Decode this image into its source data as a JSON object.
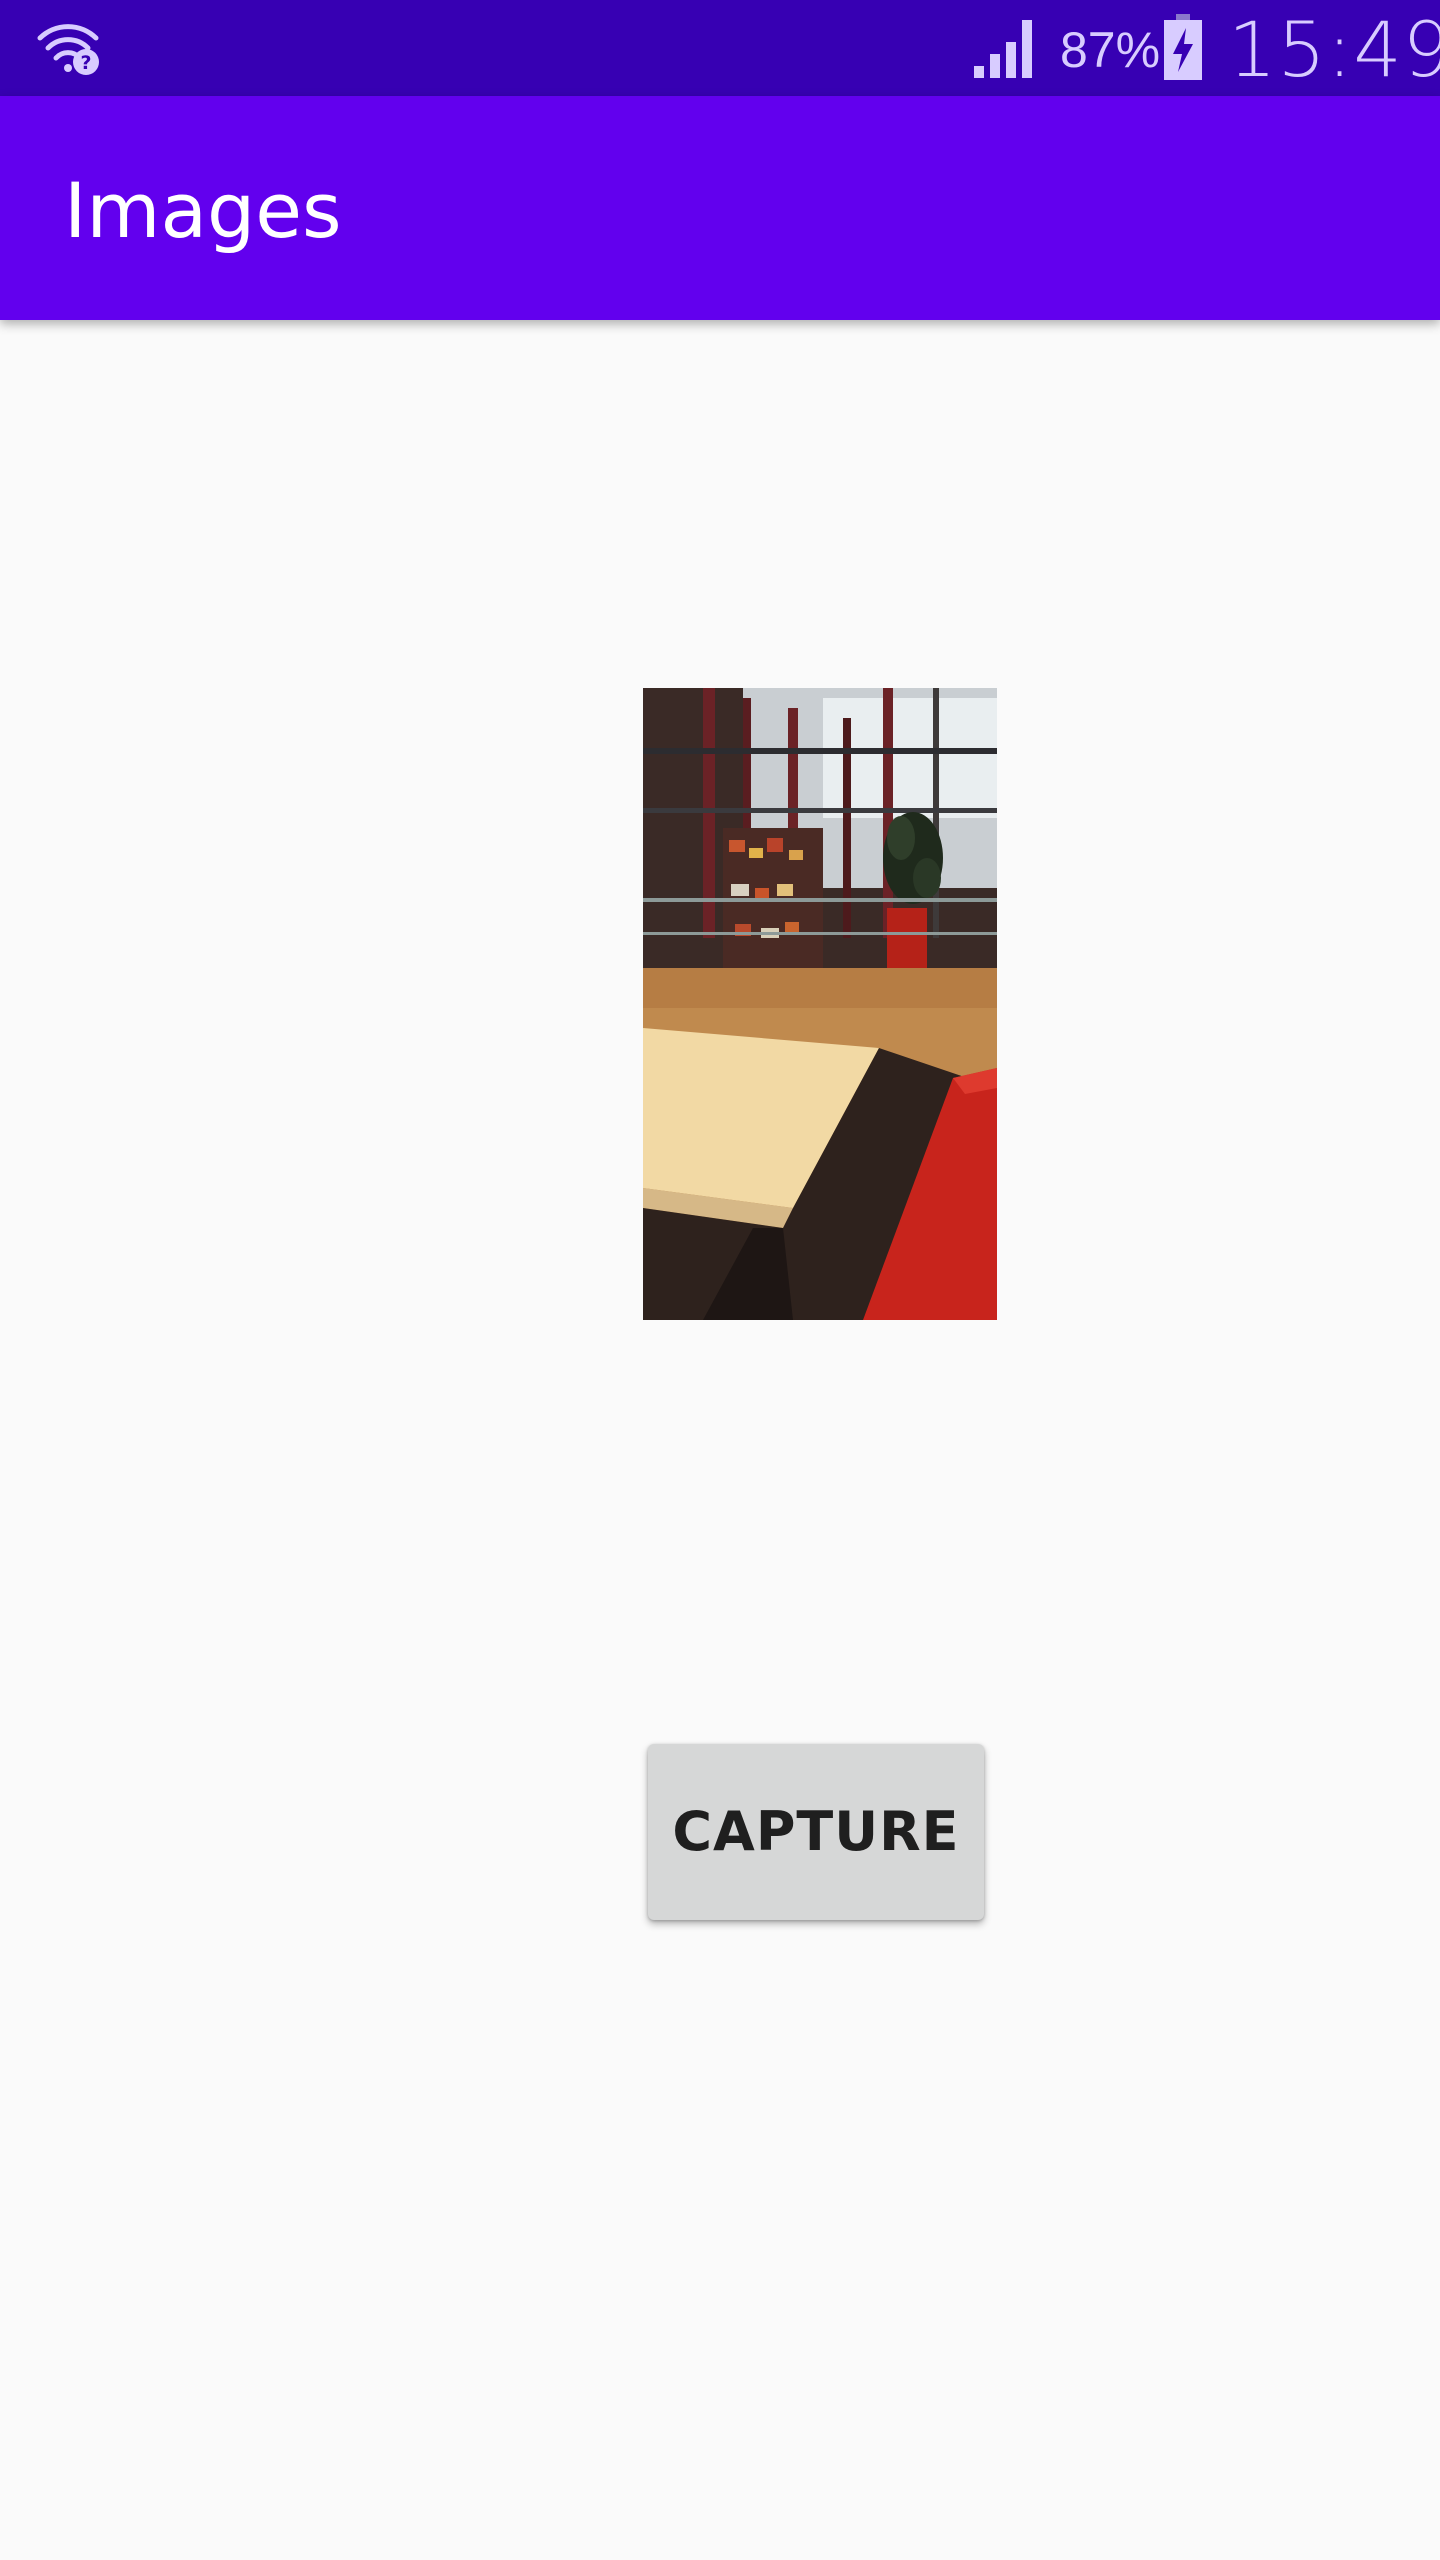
{
  "status_bar": {
    "battery_percent": "87%",
    "time": "15:49",
    "icons": [
      "wifi-unknown-icon",
      "cell-signal-icon",
      "battery-charging-icon"
    ]
  },
  "app_bar": {
    "title": "Images"
  },
  "main": {
    "image": {
      "icon": "captured-photo"
    },
    "capture_button_label": "CAPTURE"
  },
  "colors": {
    "status_bar": "#3700b3",
    "app_bar": "#6200ee",
    "background": "#fafafa",
    "button": "#d6d7d7"
  }
}
